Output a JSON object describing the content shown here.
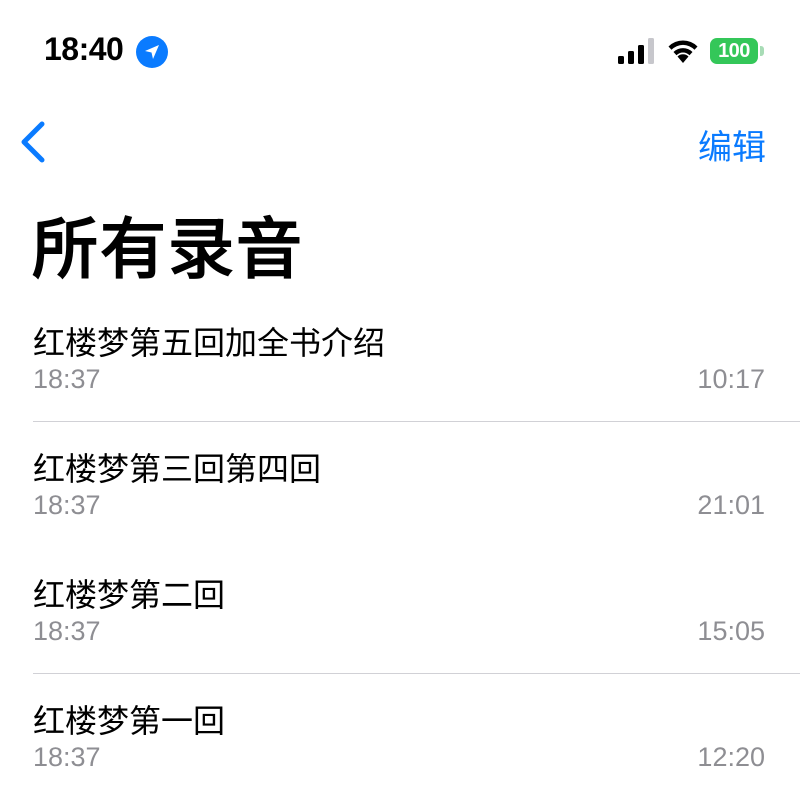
{
  "status_bar": {
    "time": "18:40",
    "battery_level": "100",
    "icons": [
      "location-arrow-icon",
      "cellular-signal-icon",
      "wifi-icon",
      "battery-icon"
    ]
  },
  "nav": {
    "back_icon": "chevron-left-icon",
    "edit_label": "编辑"
  },
  "title": "所有录音",
  "recordings": [
    {
      "title": "红楼梦第五回加全书介绍",
      "date": "18:37",
      "duration": "10:17"
    },
    {
      "title": "红楼梦第三回第四回",
      "date": "18:37",
      "duration": "21:01"
    },
    {
      "title": "红楼梦第二回",
      "date": "18:37",
      "duration": "15:05"
    },
    {
      "title": "红楼梦第一回",
      "date": "18:37",
      "duration": "12:20"
    }
  ],
  "colors": {
    "accent": "#0a7bff",
    "battery": "#34c759",
    "secondary_text": "#8e8e93",
    "divider": "#d1d1d6"
  }
}
